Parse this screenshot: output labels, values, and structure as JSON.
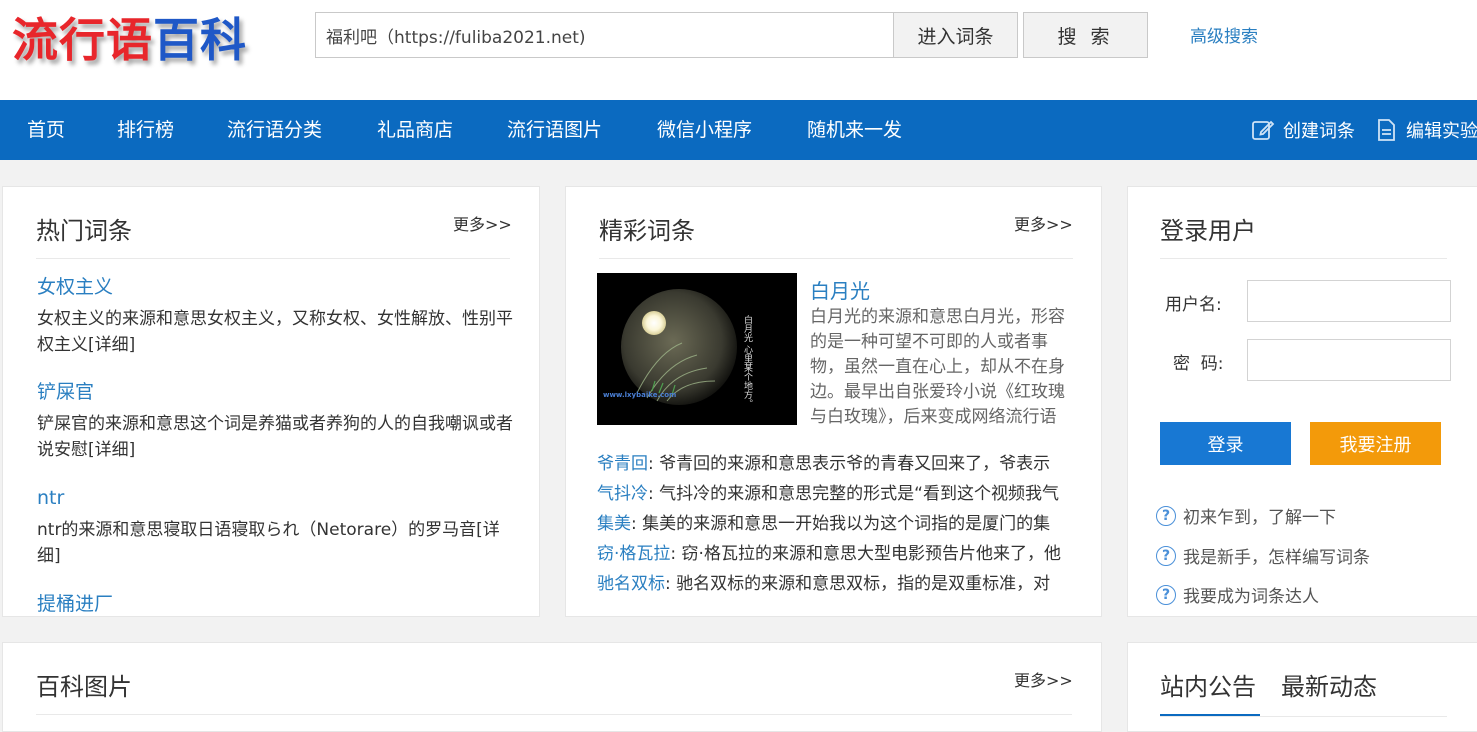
{
  "header": {
    "logo_text_red": "流行语",
    "logo_text_blue": "百科",
    "search_value": "福利吧（https://fuliba2021.net)",
    "enter_label": "进入词条",
    "search_label": "搜 索",
    "advanced_label": "高级搜索"
  },
  "nav": {
    "items": [
      "首页",
      "排行榜",
      "流行语分类",
      "礼品商店",
      "流行语图片",
      "微信小程序",
      "随机来一发"
    ],
    "create_label": "创建词条",
    "edit_label": "编辑实验"
  },
  "hot": {
    "title": "热门词条",
    "more": "更多>>",
    "items": [
      {
        "title": "女权主义",
        "desc": "女权主义的来源和意思女权主义，又称女权、女性解放、性别平权主义[详细]"
      },
      {
        "title": "铲屎官",
        "desc": "铲屎官的来源和意思这个词是养猫或者养狗的人的自我嘲讽或者说安慰[详细]"
      },
      {
        "title": "ntr",
        "desc": "ntr的来源和意思寝取日语寝取られ（Netorare）的罗马音[详细]"
      },
      {
        "title": "提桶进厂",
        "desc": ""
      }
    ]
  },
  "featured": {
    "title": "精彩词条",
    "more": "更多>>",
    "main_title": "白月光",
    "main_desc": "白月光的来源和意思白月光，形容的是一种可望不可即的人或者事物，虽然一直在心上，却从不在身边。最早出自张爱玲小说《红玫瑰与白玫瑰》，后来变成网络流行语",
    "img_vertical_text": "白月光 心里某个地方。",
    "img_watermark": "www.lxybaike.com",
    "lines": [
      {
        "key": "爷青回",
        "text": ": 爷青回的来源和意思表示爷的青春又回来了，爷表示"
      },
      {
        "key": "气抖冷",
        "text": ": 气抖冷的来源和意思完整的形式是“看到这个视频我气"
      },
      {
        "key": "集美",
        "text": ": 集美的来源和意思一开始我以为这个词指的是厦门的集"
      },
      {
        "key": "窃·格瓦拉",
        "text": ": 窃·格瓦拉的来源和意思大型电影预告片他来了，他"
      },
      {
        "key": "驰名双标",
        "text": ": 驰名双标的来源和意思双标，指的是双重标准，对"
      }
    ]
  },
  "login": {
    "title": "登录用户",
    "username_label": "用户名:",
    "password_label": "密  码:",
    "login_button": "登录",
    "register_button": "我要注册",
    "help": [
      "初来乍到，了解一下",
      "我是新手，怎样编写词条",
      "我要成为词条达人"
    ]
  },
  "images": {
    "title": "百科图片",
    "more": "更多>>"
  },
  "notice": {
    "tab1": "站内公告",
    "tab2": "最新动态"
  },
  "colors": {
    "nav_bg": "#0b6ac0",
    "link": "#2a7fc1",
    "login_btn": "#1878d3",
    "register_btn": "#f39a0a"
  }
}
